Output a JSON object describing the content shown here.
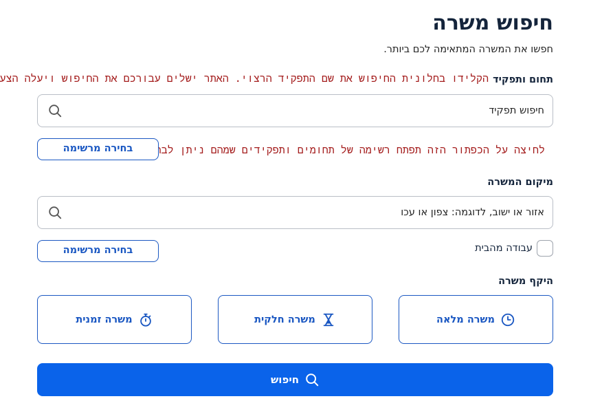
{
  "header": {
    "title": "חיפוש משרה",
    "subtitle": "חפשו את המשרה המתאימה לכם ביותר."
  },
  "field_role": {
    "label": "תחום ותפקיד",
    "hint": "הקלידו בחלונית החיפוש את שם התפקיד הרצוי. האתר ישלים עבורכם את החיפוש ויעלה הצעות",
    "value": "חיפוש תפקיד",
    "icon": "search-icon"
  },
  "list_hint": "לחיצה על הכפתור הזה תפתח רשימה של תחומים ותפקידים שמהם ניתן לבחור",
  "list_button_label": "בחירה מרשימה",
  "field_location": {
    "label": "מיקום המשרה",
    "value": "אזור או ישוב, לדוגמה: צפון או עכו",
    "icon": "search-icon"
  },
  "remote_work": {
    "label": "עבודה מהבית",
    "checked": false
  },
  "scope": {
    "label": "היקף משרה",
    "options": [
      {
        "label": "משרה מלאה",
        "icon": "clock-icon"
      },
      {
        "label": "משרה חלקית",
        "icon": "hourglass-icon"
      },
      {
        "label": "משרה זמנית",
        "icon": "stopwatch-icon"
      }
    ]
  },
  "search_button": {
    "label": "חיפוש",
    "icon": "search-icon"
  },
  "colors": {
    "primary": "#0a63ea",
    "accent": "#1a57c2",
    "hint_text": "#a31a1a",
    "title_text": "#14243b"
  }
}
